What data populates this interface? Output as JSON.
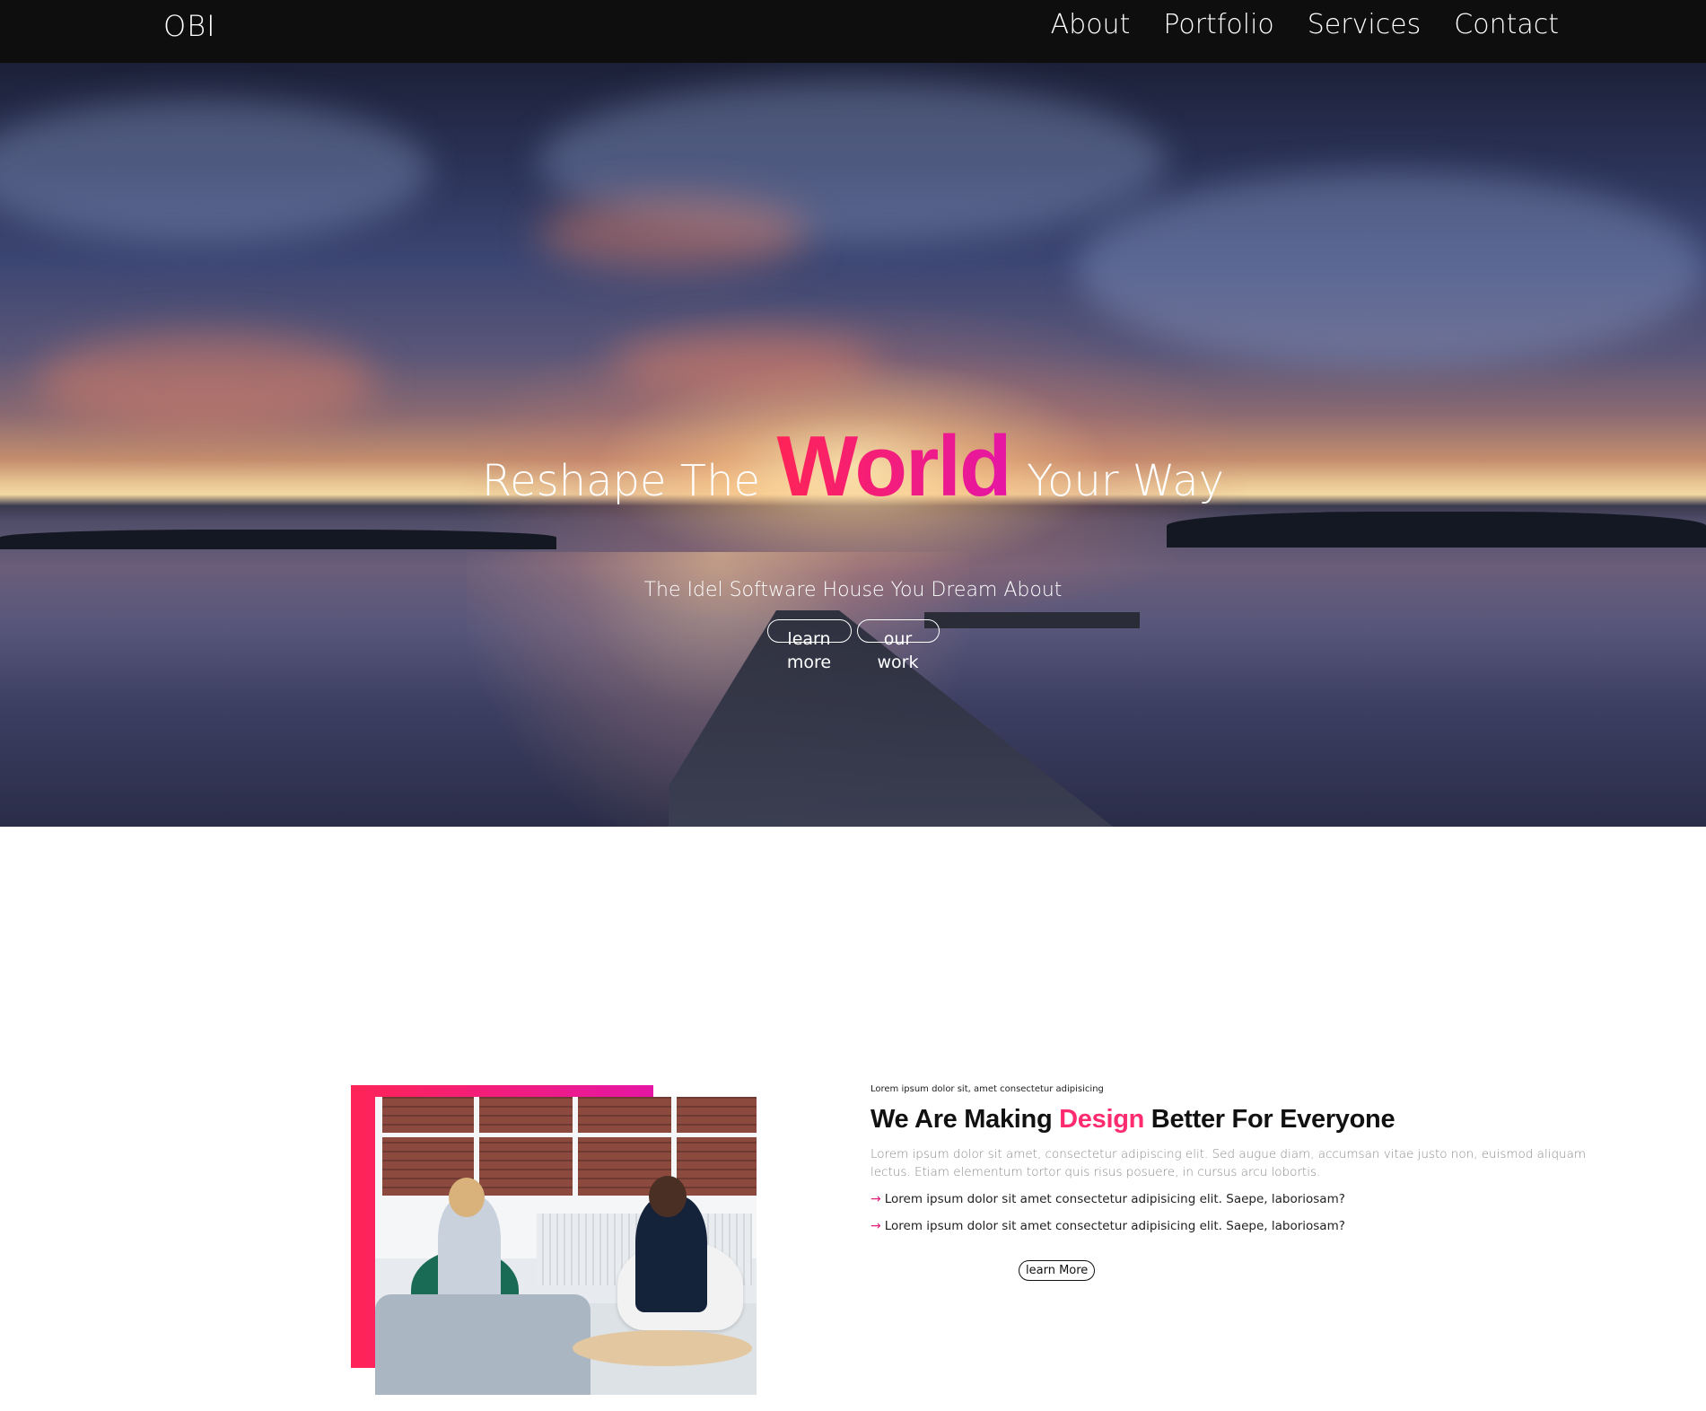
{
  "nav": {
    "brand": "OBI",
    "links": [
      "About",
      "Portfolio",
      "Services",
      "Contact"
    ]
  },
  "hero": {
    "title_before": "Reshape The",
    "title_highlight": "World",
    "title_after": "Your Way",
    "subtitle": "The Idel Software House You Dream About",
    "buttons": [
      "learn more",
      "our work"
    ]
  },
  "about": {
    "eyebrow": "Lorem ipsum dolor sit, amet consectetur adipisicing",
    "heading_before": "We Are Making",
    "heading_accent": "Design",
    "heading_after": "Better For Everyone",
    "description": "Lorem ipsum dolor sit amet, consectetur adipiscing elit. Sed augue diam, accumsan vitae justo non, euismod aliquam lectus. Etiam elementum tortor quis risus posuere, in cursus arcu lobortis.",
    "bullets": [
      "Lorem ipsum dolor sit amet consectetur adipisicing elit. Saepe, laboriosam?",
      "Lorem ipsum dolor sit amet consectetur adipisicing elit. Saepe, laboriosam?"
    ],
    "cta": "learn More"
  },
  "colors": {
    "accent_start": "#ff2457",
    "accent_end": "#e516a5",
    "navbar_bg": "#0e0e0e"
  },
  "icons": {
    "bullet": "arrow-right-icon"
  }
}
